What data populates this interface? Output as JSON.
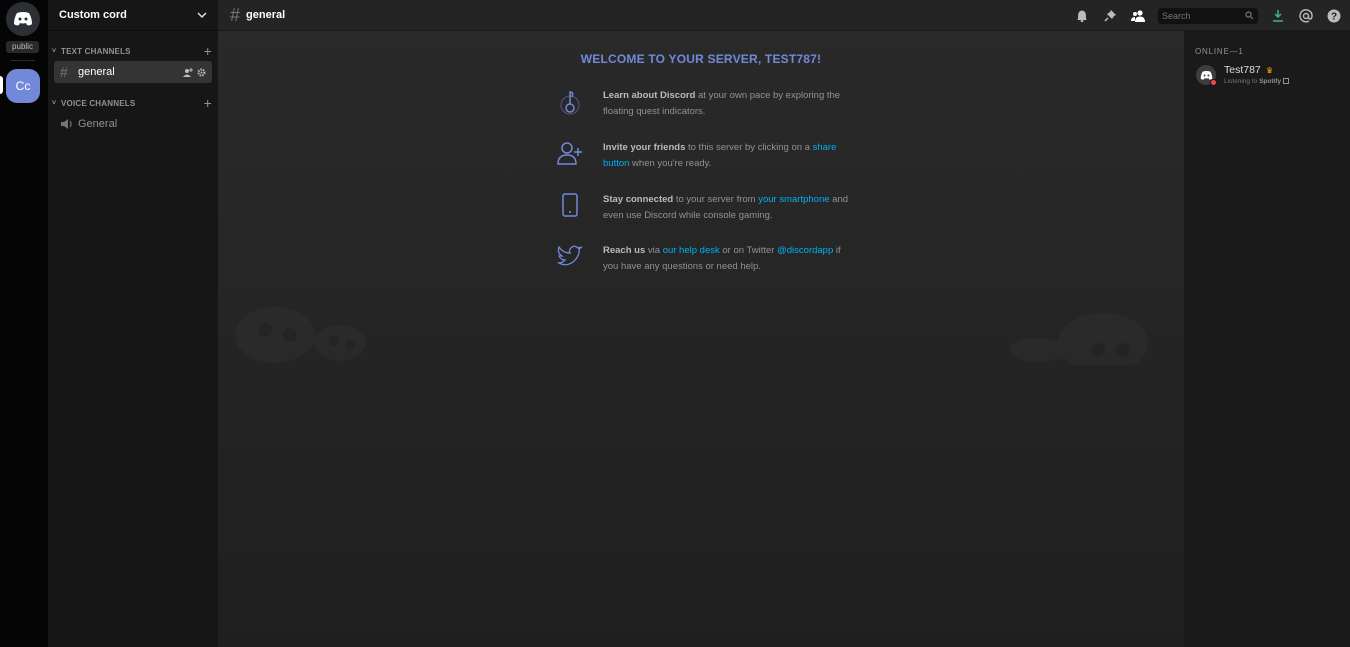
{
  "rail": {
    "public_tag": "public",
    "server_initials": "Cc"
  },
  "sidebar": {
    "guild_name": "Custom cord",
    "categories": [
      {
        "label": "TEXT CHANNELS"
      },
      {
        "label": "VOICE CHANNELS"
      }
    ],
    "text_channels": [
      {
        "label": "general"
      }
    ],
    "voice_channels": [
      {
        "label": "General"
      }
    ]
  },
  "topbar": {
    "channel": "general",
    "search_placeholder": "Search"
  },
  "welcome": {
    "title": "WELCOME TO YOUR SERVER, TEST787!",
    "tips": [
      {
        "bold": "Learn about Discord",
        "rest1": " at your own pace by exploring the floating quest indicators.",
        "link": "",
        "rest2": ""
      },
      {
        "bold": "Invite your friends",
        "rest1": " to this server by clicking on a ",
        "link": "share button",
        "rest2": " when you're ready."
      },
      {
        "bold": "Stay connected",
        "rest1": " to your server from ",
        "link": "your smartphone",
        "rest2": " and even use Discord while console gaming."
      },
      {
        "bold": "Reach us",
        "rest1": " via ",
        "link": "our help desk",
        "rest2": " or on Twitter ",
        "link2": "@discordapp",
        "rest3": " if you have any questions or need help."
      }
    ]
  },
  "members": {
    "online_header": "ONLINE—1",
    "list": [
      {
        "name": "Test787",
        "activity_prefix": "Listening to ",
        "activity_name": "Spotify"
      }
    ]
  },
  "colors": {
    "accent": "#7289da",
    "link": "#00b0f4",
    "status_dnd": "#f04747",
    "crown": "#faa61a",
    "download": "#43b581"
  }
}
